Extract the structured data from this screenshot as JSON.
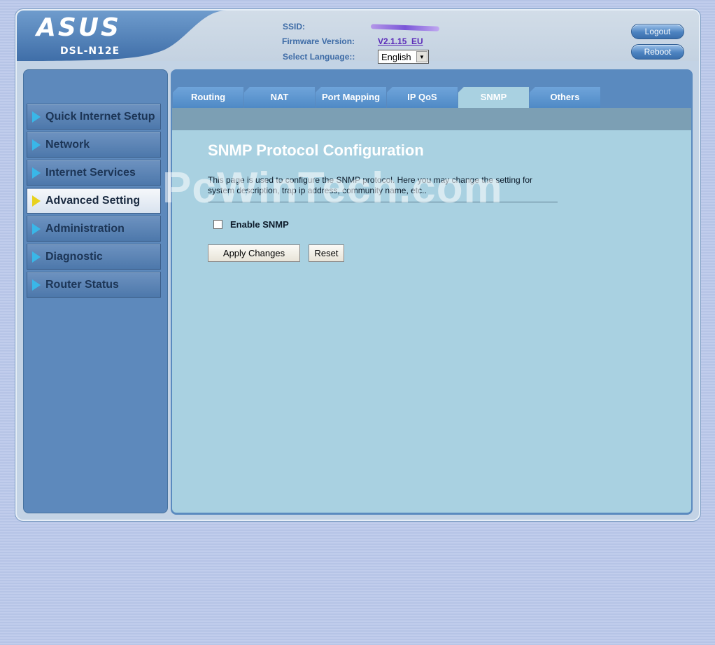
{
  "header": {
    "brand": "ASUS",
    "model": "DSL-N12E",
    "ssid_label": "SSID:",
    "firmware_label": "Firmware Version:",
    "firmware_value": "V2.1.15_EU",
    "language_label": "Select Language::",
    "language_value": "English",
    "logout_label": "Logout",
    "reboot_label": "Reboot"
  },
  "sidebar": {
    "items": [
      {
        "label": "Quick Internet Setup"
      },
      {
        "label": "Network"
      },
      {
        "label": "Internet Services"
      },
      {
        "label": "Advanced Setting"
      },
      {
        "label": "Administration"
      },
      {
        "label": "Diagnostic"
      },
      {
        "label": "Router Status"
      }
    ],
    "active": "Advanced Setting"
  },
  "tabs": [
    {
      "label": "Routing"
    },
    {
      "label": "NAT"
    },
    {
      "label": "Port Mapping"
    },
    {
      "label": "IP QoS"
    },
    {
      "label": "SNMP"
    },
    {
      "label": "Others"
    }
  ],
  "active_tab": "SNMP",
  "main": {
    "title": "SNMP Protocol Configuration",
    "description": "This page is used to configure the SNMP protocol. Here you may change the setting for system description, trap ip address, community name, etc..",
    "watermark": "PcWinTech.com",
    "enable_snmp_label": "Enable SNMP",
    "enable_snmp_checked": false,
    "apply_label": "Apply Changes",
    "reset_label": "Reset"
  },
  "colors": {
    "accent": "#5a8abf",
    "content_bg": "#a9d1e1",
    "menu_arrow": "#39b7e8",
    "active_arrow": "#e8d21e"
  }
}
